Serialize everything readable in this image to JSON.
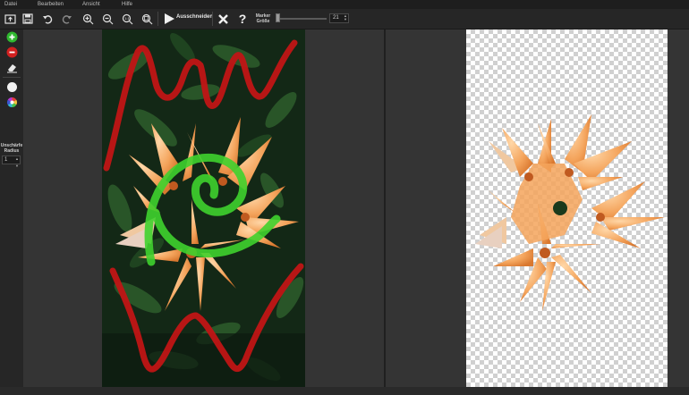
{
  "menu": {
    "items": [
      "Datei",
      "Bearbeiten",
      "Ansicht",
      "Hilfe"
    ]
  },
  "toolbar": {
    "cut_label": "Ausschneiden",
    "marker_label_line1": "Marker",
    "marker_label_line2": "Größe",
    "marker_size": "21",
    "icons": [
      "open-icon",
      "save-icon",
      "undo-icon",
      "redo-icon",
      "zoom-in-icon",
      "zoom-out-icon",
      "zoom-actual-icon",
      "zoom-fit-icon",
      "play-icon",
      "close-icon",
      "help-icon"
    ]
  },
  "sidebar": {
    "blur_label_line1": "Unschärfe",
    "blur_label_line2": "Radius",
    "blur_value": "1",
    "icons": [
      "add-marker-icon",
      "remove-marker-icon",
      "eraser-icon",
      "white-circle-icon",
      "color-wheel-icon"
    ]
  },
  "colors": {
    "keep_marker": "#3fd12e",
    "remove_marker": "#c01515",
    "accent_add": "#2fb82f",
    "accent_remove": "#d22020",
    "flower": "#f4a45c"
  }
}
